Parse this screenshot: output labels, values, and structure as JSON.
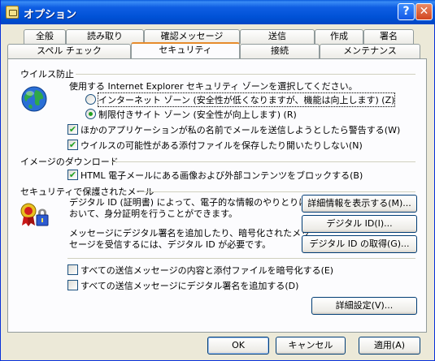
{
  "window": {
    "title": "オプション",
    "help_label": "?",
    "close_label": "✕"
  },
  "tabs_top": [
    "全般",
    "読み取り",
    "確認メッセージ",
    "送信",
    "作成",
    "署名"
  ],
  "tabs_bottom": [
    "スペル チェック",
    "セキュリティ",
    "接続",
    "メンテナンス"
  ],
  "active_tab": "セキュリティ",
  "virus": {
    "heading": "ウイルス防止",
    "zone_prompt": "使用する Internet Explorer セキュリティ ゾーンを選択してください。",
    "radio_internet": "インターネット ゾーン (安全性が低くなりますが、機能は向上します) (Z)",
    "radio_restricted": "制限付きサイト ゾーン (安全性が向上します) (R)",
    "check_warn": "ほかのアプリケーションが私の名前でメールを送信しようとしたら警告する(W)",
    "check_attach": "ウイルスの可能性がある添付ファイルを保存したり開いたりしない(N)"
  },
  "image": {
    "heading": "イメージのダウンロード",
    "check_block": "HTML 電子メールにある画像および外部コンテンツをブロックする(B)"
  },
  "secure": {
    "heading": "セキュリティで保護されたメール",
    "desc1_line1": "デジタル ID (証明書) によって、電子的な情報のやりとりに",
    "desc1_line2": "おいて、身分証明を行うことができます。",
    "desc2_line1": "メッセージにデジタル署名を追加したり、暗号化されたメッ",
    "desc2_line2": "セージを受信するには、デジタル ID が必要です。",
    "btn_details": "詳細情報を表示する(M)...",
    "btn_digital_id": "デジタル ID(I)...",
    "btn_get_id": "デジタル ID の取得(G)...",
    "check_encrypt": "すべての送信メッセージの内容と添付ファイルを暗号化する(E)",
    "check_sign": "すべての送信メッセージにデジタル署名を追加する(D)",
    "btn_advanced": "詳細設定(V)..."
  },
  "footer": {
    "ok": "OK",
    "cancel": "キャンセル",
    "apply": "適用(A)"
  }
}
